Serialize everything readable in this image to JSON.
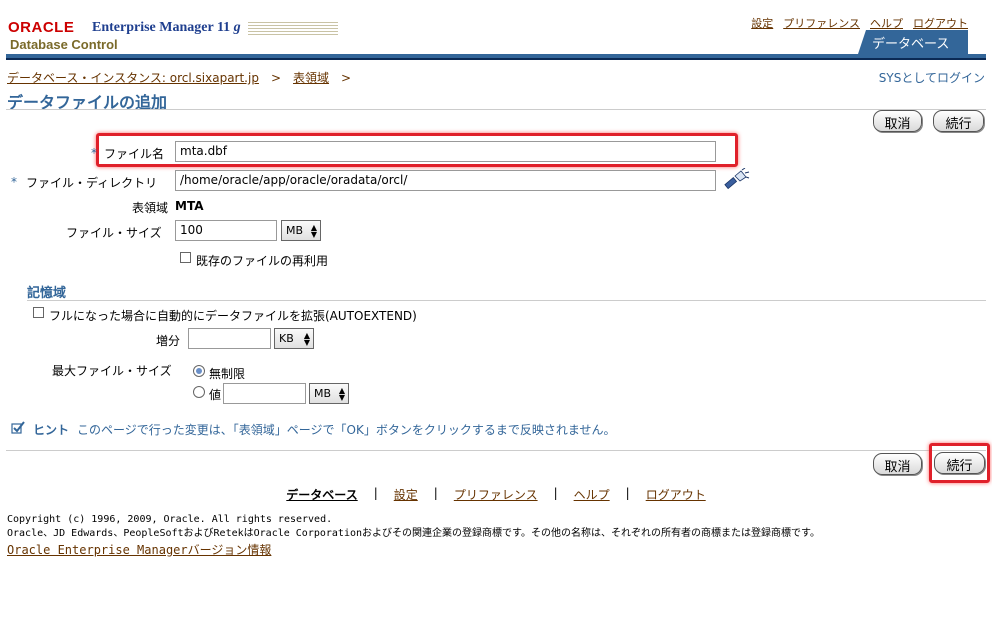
{
  "header": {
    "logo_oracle": "ORACLE",
    "logo_product": "Enterprise Manager 11",
    "logo_version": "g",
    "logo_subtitle": "Database Control",
    "global_links": [
      "設定",
      "プリファレンス",
      "ヘルプ",
      "ログアウト"
    ],
    "tab_label": "データベース"
  },
  "breadcrumb": {
    "items": [
      "データベース・インスタンス: orcl.sixapart.jp",
      "表領域"
    ],
    "separator": ">"
  },
  "syslogin": "SYSとしてログイン",
  "page_title": "データファイルの追加",
  "buttons": {
    "cancel": "取消",
    "continue": "続行"
  },
  "form": {
    "required_mark": "*",
    "file_name_label": "ファイル名",
    "file_name_value": "mta.dbf",
    "file_dir_label": "ファイル・ディレクトリ",
    "file_dir_value": "/home/oracle/app/oracle/oradata/orcl/",
    "tablespace_label": "表領域",
    "tablespace_value": "MTA",
    "file_size_label": "ファイル・サイズ",
    "file_size_value": "100",
    "file_size_unit": "MB",
    "reuse_label": "既存のファイルの再利用"
  },
  "storage": {
    "heading": "記憶域",
    "autoextend_label": "フルになった場合に自動的にデータファイルを拡張(AUTOEXTEND)",
    "increment_label": "増分",
    "increment_value": "",
    "increment_unit": "KB",
    "max_size_label": "最大ファイル・サイズ",
    "unlimited_label": "無制限",
    "value_label": "値",
    "value_value": "",
    "value_unit": "MB"
  },
  "hint": {
    "label": "ヒント",
    "text": "このページで行った変更は、「表領域」ページで「OK」ボタンをクリックするまで反映されません。"
  },
  "footer": {
    "nav": [
      "データベース",
      "設定",
      "プリファレンス",
      "ヘルプ",
      "ログアウト"
    ],
    "separator": "|",
    "copyright_line1": "Copyright (c) 1996, 2009, Oracle. All rights reserved.",
    "copyright_line2": "Oracle、JD Edwards、PeopleSoftおよびRetekはOracle Corporationおよびその関連企業の登録商標です。その他の名称は、それぞれの所有者の商標または登録商標です。",
    "version_link": "Oracle Enterprise Managerバージョン情報"
  },
  "icons": {
    "flashlight": "flashlight-search-icon",
    "hint": "checkmark-hint-icon"
  },
  "colors": {
    "brand_blue": "#336699",
    "link_brown": "#663300",
    "oracle_red": "#cc0000",
    "highlight_red": "#e0202a"
  }
}
